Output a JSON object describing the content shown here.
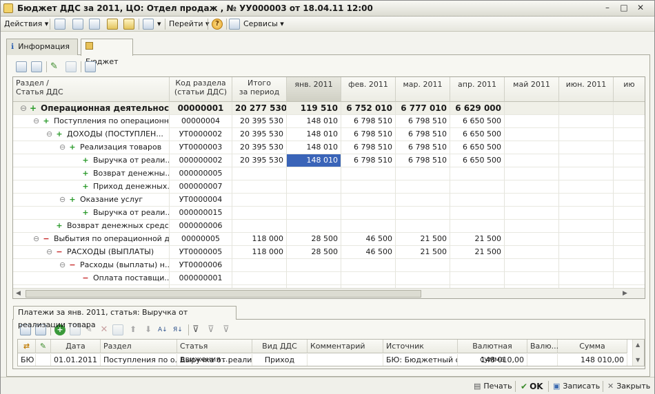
{
  "window": {
    "title": "Бюджет ДДС за 2011, ЦО: Отдел продаж , № УУ000003 от 18.04.11 12:00"
  },
  "menu": {
    "actions": "Действия",
    "go": "Перейти",
    "services": "Сервисы"
  },
  "tabs": [
    "Информация",
    "Бюджет"
  ],
  "grid": {
    "headers": {
      "section": "Раздел /\nСтатья ДДС",
      "code": "Код раздела\n(статьи ДДС)",
      "total": "Итого\nза период",
      "months": [
        "янв. 2011",
        "фев. 2011",
        "мар. 2011",
        "апр. 2011",
        "май 2011",
        "июн. 2011",
        "ию"
      ]
    },
    "rows": [
      {
        "indent": 0,
        "toggle": "⊖",
        "sign": "+",
        "name": "Операционная деятельность",
        "code": "00000001",
        "total": "20 277 530",
        "m": [
          "119 510",
          "6 752 010",
          "6 777 010",
          "6 629 000",
          "",
          ""
        ],
        "style": "bold gray"
      },
      {
        "indent": 1,
        "toggle": "⊖",
        "sign": "+",
        "name": "Поступления по операционн...",
        "code": "00000004",
        "total": "20 395 530",
        "m": [
          "148 010",
          "6 798 510",
          "6 798 510",
          "6 650 500",
          "",
          ""
        ]
      },
      {
        "indent": 2,
        "toggle": "⊖",
        "sign": "+",
        "name": "ДОХОДЫ (ПОСТУПЛЕН...",
        "code": "УТ0000002",
        "total": "20 395 530",
        "m": [
          "148 010",
          "6 798 510",
          "6 798 510",
          "6 650 500",
          "",
          ""
        ]
      },
      {
        "indent": 3,
        "toggle": "⊖",
        "sign": "+",
        "name": "Реализация товаров",
        "code": "УТ0000003",
        "total": "20 395 530",
        "m": [
          "148 010",
          "6 798 510",
          "6 798 510",
          "6 650 500",
          "",
          ""
        ]
      },
      {
        "indent": 4,
        "toggle": "",
        "sign": "+",
        "name": "Выручка от реали...",
        "code": "000000002",
        "total": "20 395 530",
        "m": [
          "148 010",
          "6 798 510",
          "6 798 510",
          "6 650 500",
          "",
          ""
        ],
        "selected": 0
      },
      {
        "indent": 4,
        "toggle": "",
        "sign": "+",
        "name": "Возврат денежны...",
        "code": "000000005",
        "total": "",
        "m": [
          "",
          "",
          "",
          "",
          "",
          ""
        ]
      },
      {
        "indent": 4,
        "toggle": "",
        "sign": "+",
        "name": "Приход денежных...",
        "code": "000000007",
        "total": "",
        "m": [
          "",
          "",
          "",
          "",
          "",
          ""
        ]
      },
      {
        "indent": 3,
        "toggle": "⊖",
        "sign": "+",
        "name": "Оказание услуг",
        "code": "УТ0000004",
        "total": "",
        "m": [
          "",
          "",
          "",
          "",
          "",
          ""
        ]
      },
      {
        "indent": 4,
        "toggle": "",
        "sign": "+",
        "name": "Выручка от реали...",
        "code": "000000015",
        "total": "",
        "m": [
          "",
          "",
          "",
          "",
          "",
          ""
        ]
      },
      {
        "indent": 2,
        "toggle": "",
        "sign": "+",
        "name": "Возврат денежных средс...",
        "code": "000000006",
        "total": "",
        "m": [
          "",
          "",
          "",
          "",
          "",
          ""
        ]
      },
      {
        "indent": 1,
        "toggle": "⊖",
        "sign": "−",
        "name": "Выбытия по операционной д...",
        "code": "00000005",
        "total": "118 000",
        "m": [
          "28 500",
          "46 500",
          "21 500",
          "21 500",
          "",
          ""
        ]
      },
      {
        "indent": 2,
        "toggle": "⊖",
        "sign": "−",
        "name": "РАСХОДЫ (ВЫПЛАТЫ)",
        "code": "УТ0000005",
        "total": "118 000",
        "m": [
          "28 500",
          "46 500",
          "21 500",
          "21 500",
          "",
          ""
        ]
      },
      {
        "indent": 3,
        "toggle": "⊖",
        "sign": "−",
        "name": "Расходы (выплаты) н...",
        "code": "УТ0000006",
        "total": "",
        "m": [
          "",
          "",
          "",
          "",
          "",
          ""
        ]
      },
      {
        "indent": 4,
        "toggle": "",
        "sign": "−",
        "name": "Оплата поставщи...",
        "code": "000000001",
        "total": "",
        "m": [
          "",
          "",
          "",
          "",
          "",
          ""
        ]
      },
      {
        "indent": 4,
        "toggle": "",
        "sign": "",
        "name": "",
        "code": "000000004",
        "total": "",
        "m": [
          "",
          "",
          "",
          "",
          "",
          ""
        ]
      }
    ]
  },
  "bottom": {
    "tab": "Платежи за янв. 2011, статья: Выручка от реализации товара",
    "headers": [
      "Дата",
      "Раздел",
      "Статья движения ...",
      "Вид ДДС",
      "Комментарий",
      "Источник",
      "Валютная сумма",
      "Валю...",
      "Сумма"
    ],
    "row": {
      "icon": "БЮ",
      "date": "01.01.2011",
      "section": "Поступления по о...",
      "article": "Выручка от реали...",
      "kind": "Приход",
      "comment": "",
      "source": "БЮ: Бюджетный о...",
      "currency_sum": "148 010,00",
      "currency": "",
      "sum": "148 010,00"
    }
  },
  "status": {
    "print": "Печать",
    "ok": "OK",
    "save": "Записать",
    "close": "Закрыть"
  }
}
